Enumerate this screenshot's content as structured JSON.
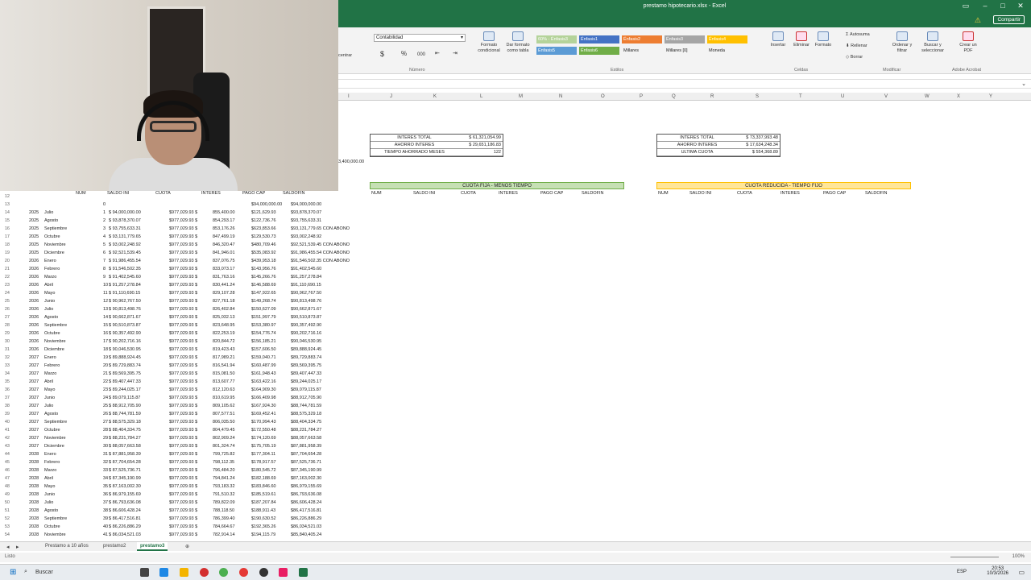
{
  "window": {
    "title": "prestamo hipotecario.xlsx - Excel",
    "share": "Compartir"
  },
  "ribbon": {
    "number_format": "Contabilidad",
    "groups": {
      "number": "Número",
      "styles": "Estilos",
      "cells": "Celdas",
      "modify": "Modificar",
      "acrobat": "Adobe Acrobat"
    },
    "buttons": {
      "cond_format": "Formato condicional",
      "table_format": "Dar formato como tabla",
      "insert": "Insertar",
      "delete": "Eliminar",
      "format": "Formato",
      "autosum": "Autosuma",
      "fill": "Rellenar",
      "clear": "Borrar",
      "sort": "Ordenar y filtrar",
      "find": "Buscar y seleccionar",
      "pdf": "Crear un PDF",
      "center": "centrar"
    },
    "styles": [
      "60% - Énfasis3",
      "Énfasis1",
      "Énfasis2",
      "Énfasis3",
      "Énfasis4",
      "Énfasis5",
      "Énfasis6",
      "Millares",
      "Millares [0]",
      "Moneda"
    ]
  },
  "columns": [
    "I",
    "J",
    "K",
    "L",
    "M",
    "N",
    "O",
    "P",
    "Q",
    "R",
    "S",
    "T",
    "U",
    "V",
    "W",
    "X",
    "Y"
  ],
  "stray": "3,400,000.00",
  "summary_mid": [
    {
      "label": "INTERES TOTAL",
      "value": "$ 61,321,054.99"
    },
    {
      "label": "AHORRO INTERES",
      "value": "$ 29,651,186.83"
    },
    {
      "label": "TIEMPO AHORRADO MESES",
      "value": "122"
    }
  ],
  "summary_right": [
    {
      "label": "INTERES TOTAL",
      "value": "$ 73,337,993.48"
    },
    {
      "label": "AHORRO INTERES",
      "value": "$ 17,634,248.34"
    },
    {
      "label": "ULTIMA CUOTA",
      "value": "$ 554,368.89"
    }
  ],
  "banners": {
    "mid": "CUOTA FIJA - MENOS TIEMPO",
    "right": "CUOTA REDUCIDA - TIEMPO FIJO"
  },
  "headers_left": [
    "NUM",
    "SALDO INI",
    "CUOTA",
    "INTERES",
    "PAGO CAP",
    "SALDOFIN"
  ],
  "headers_mid": [
    "NUM",
    "SALDO INI",
    "CUOTA",
    "INTERES",
    "PAGO CAP",
    "SALDOFIN"
  ],
  "headers_right": [
    "NUM",
    "SALDO INI",
    "CUOTA",
    "INTERES",
    "PAGO CAP",
    "SALDOFIN"
  ],
  "left_rows": [
    [
      "12",
      "",
      "",
      "",
      "",
      "",
      "",
      ""
    ],
    [
      "13",
      "",
      "",
      "0",
      "",
      "",
      "",
      "$94,000,000.00"
    ],
    [
      "14",
      "2025",
      "Julio",
      "1",
      "$ 94,000,000.00",
      "$977,029.93 $",
      "855,400.00",
      "$121,629.93"
    ],
    [
      "15",
      "2025",
      "Agosto",
      "2",
      "$ 93,878,370.07",
      "$977,029.93 $",
      "854,293.17",
      "$122,736.76"
    ],
    [
      "16",
      "2025",
      "Septiembre",
      "3",
      "$ 93,755,633.31",
      "$977,029.93 $",
      "853,176.26",
      "$623,853.66"
    ],
    [
      "17",
      "2025",
      "Octubre",
      "4",
      "$ 93,131,779.65",
      "$977,029.93 $",
      "847,499.19",
      "$129,530.73"
    ],
    [
      "18",
      "2025",
      "Noviembre",
      "5",
      "$ 93,002,248.92",
      "$977,029.93 $",
      "846,320.47",
      "$480,709.46"
    ],
    [
      "19",
      "2025",
      "Diciembre",
      "6",
      "$ 92,521,539.45",
      "$977,029.93 $",
      "841,946.01",
      "$535,083.92"
    ],
    [
      "20",
      "2026",
      "Enero",
      "7",
      "$ 91,986,455.54",
      "$977,029.93 $",
      "837,076.75",
      "$439,953.18"
    ],
    [
      "21",
      "2026",
      "Febrero",
      "8",
      "$ 91,546,502.35",
      "$977,029.93 $",
      "833,073.17",
      "$143,956.76"
    ],
    [
      "22",
      "2026",
      "Marzo",
      "9",
      "$ 91,402,545.60",
      "$977,029.93 $",
      "831,763.16",
      "$145,266.76"
    ],
    [
      "23",
      "2026",
      "Abril",
      "10",
      "$ 91,257,278.84",
      "$977,029.93 $",
      "830,441.24",
      "$146,588.69"
    ],
    [
      "24",
      "2026",
      "Mayo",
      "11",
      "$ 91,110,690.15",
      "$977,029.93 $",
      "829,107.28",
      "$147,922.65"
    ],
    [
      "25",
      "2026",
      "Junio",
      "12",
      "$ 90,962,767.50",
      "$977,029.93 $",
      "827,761.18",
      "$149,268.74"
    ],
    [
      "26",
      "2026",
      "Julio",
      "13",
      "$ 90,813,498.76",
      "$977,029.93 $",
      "826,402.84",
      "$150,627.09"
    ],
    [
      "27",
      "2026",
      "Agosto",
      "14",
      "$ 90,662,871.67",
      "$977,029.93 $",
      "825,032.13",
      "$151,997.79"
    ],
    [
      "28",
      "2026",
      "Septiembre",
      "15",
      "$ 90,510,873.87",
      "$977,029.93 $",
      "823,648.95",
      "$153,380.97"
    ],
    [
      "29",
      "2026",
      "Octubre",
      "16",
      "$ 90,357,492.90",
      "$977,029.93 $",
      "822,253.19",
      "$154,776.74"
    ],
    [
      "30",
      "2026",
      "Noviembre",
      "17",
      "$ 90,202,716.16",
      "$977,029.93 $",
      "820,844.72",
      "$156,185.21"
    ],
    [
      "31",
      "2026",
      "Diciembre",
      "18",
      "$ 90,046,530.95",
      "$977,029.93 $",
      "819,423.43",
      "$157,606.50"
    ],
    [
      "32",
      "2027",
      "Enero",
      "19",
      "$ 89,888,924.45",
      "$977,029.93 $",
      "817,989.21",
      "$159,040.71"
    ],
    [
      "33",
      "2027",
      "Febrero",
      "20",
      "$ 89,729,883.74",
      "$977,029.93 $",
      "816,541.94",
      "$160,487.99"
    ],
    [
      "34",
      "2027",
      "Marzo",
      "21",
      "$ 89,569,395.75",
      "$977,029.93 $",
      "815,081.50",
      "$161,948.43"
    ],
    [
      "35",
      "2027",
      "Abril",
      "22",
      "$ 89,407,447.33",
      "$977,029.93 $",
      "813,607.77",
      "$163,422.16"
    ],
    [
      "36",
      "2027",
      "Mayo",
      "23",
      "$ 89,244,025.17",
      "$977,029.93 $",
      "812,120.63",
      "$164,909.30"
    ],
    [
      "37",
      "2027",
      "Junio",
      "24",
      "$ 89,079,115.87",
      "$977,029.93 $",
      "810,619.95",
      "$166,409.98"
    ],
    [
      "38",
      "2027",
      "Julio",
      "25",
      "$ 88,912,705.90",
      "$977,029.93 $",
      "809,105.62",
      "$167,924.30"
    ],
    [
      "39",
      "2027",
      "Agosto",
      "26",
      "$ 88,744,781.59",
      "$977,029.93 $",
      "807,577.51",
      "$169,452.41"
    ],
    [
      "40",
      "2027",
      "Septiembre",
      "27",
      "$ 88,575,329.18",
      "$977,029.93 $",
      "806,035.50",
      "$170,994.43"
    ],
    [
      "41",
      "2027",
      "Octubre",
      "28",
      "$ 88,404,334.75",
      "$977,029.93 $",
      "804,479.45",
      "$172,550.48"
    ],
    [
      "42",
      "2027",
      "Noviembre",
      "29",
      "$ 88,231,784.27",
      "$977,029.93 $",
      "802,909.24",
      "$174,120.69"
    ],
    [
      "43",
      "2027",
      "Diciembre",
      "30",
      "$ 88,057,663.58",
      "$977,029.93 $",
      "801,324.74",
      "$175,705.19"
    ],
    [
      "44",
      "2028",
      "Enero",
      "31",
      "$ 87,881,958.39",
      "$977,029.93 $",
      "799,725.82",
      "$177,304.11"
    ],
    [
      "45",
      "2028",
      "Febrero",
      "32",
      "$ 87,704,654.28",
      "$977,029.93 $",
      "798,112.35",
      "$178,917.57"
    ],
    [
      "46",
      "2028",
      "Marzo",
      "33",
      "$ 87,525,736.71",
      "$977,029.93 $",
      "796,484.20",
      "$180,545.72"
    ],
    [
      "47",
      "2028",
      "Abril",
      "34",
      "$ 87,345,190.99",
      "$977,029.93 $",
      "794,841.24",
      "$182,188.69"
    ],
    [
      "48",
      "2028",
      "Mayo",
      "35",
      "$ 87,163,002.30",
      "$977,029.93 $",
      "793,183.32",
      "$183,846.60"
    ],
    [
      "49",
      "2028",
      "Junio",
      "36",
      "$ 86,979,155.69",
      "$977,029.93 $",
      "791,510.32",
      "$185,519.61"
    ],
    [
      "50",
      "2028",
      "Julio",
      "37",
      "$ 86,793,636.08",
      "$977,029.93 $",
      "789,822.09",
      "$187,207.84"
    ],
    [
      "51",
      "2028",
      "Agosto",
      "38",
      "$ 86,606,428.24",
      "$977,029.93 $",
      "788,118.50",
      "$188,911.43"
    ],
    [
      "52",
      "2028",
      "Septiembre",
      "39",
      "$ 86,417,516.81",
      "$977,029.93 $",
      "786,399.40",
      "$190,630.52"
    ],
    [
      "53",
      "2028",
      "Octubre",
      "40",
      "$ 86,226,886.29",
      "$977,029.93 $",
      "784,664.67",
      "$192,365.26"
    ],
    [
      "54",
      "2028",
      "Noviembre",
      "41",
      "$ 86,034,521.03",
      "$977,029.93 $",
      "782,914.14",
      "$194,115.79"
    ]
  ],
  "left_saldofin": [
    "",
    "$94,000,000.00",
    "$93,878,370.07",
    "$93,755,633.31",
    "$93,131,779.65 CON ABONO",
    "$93,002,248.92",
    "$92,521,539.45 CON ABONO",
    "$91,986,455.54 CON ABONO",
    "$91,546,502.35 CON ABONO",
    "$91,402,545.60",
    "$91,257,278.84",
    "$91,110,690.15",
    "$90,962,767.50",
    "$90,813,498.76",
    "$90,662,871.67",
    "$90,510,873.87",
    "$90,357,492.90",
    "$90,202,716.16",
    "$90,046,530.95",
    "$89,888,924.45",
    "$89,729,883.74",
    "$89,569,395.75",
    "$89,407,447.33",
    "$89,244,025.17",
    "$89,079,115.87",
    "$88,912,705.90",
    "$88,744,781.59",
    "$88,575,329.18",
    "$88,404,334.75",
    "$88,231,784.27",
    "$88,057,663.58",
    "$87,881,958.39",
    "$87,704,654.28",
    "$87,525,736.71",
    "$87,345,190.99",
    "$87,163,002.30",
    "$86,979,155.69",
    "$86,793,636.08",
    "$86,606,428.24",
    "$86,417,516.81",
    "$86,226,886.29",
    "$86,034,521.03",
    "$85,840,405.24"
  ],
  "sheet_tabs": [
    "Prestamo a 10 años",
    "prestamo2",
    "prestamo3"
  ],
  "status": {
    "ready": "Listo",
    "zoom": "100%"
  },
  "taskbar": {
    "search": "Buscar",
    "time": "20:53",
    "date": "10/3/2026",
    "lang": "ESP"
  }
}
